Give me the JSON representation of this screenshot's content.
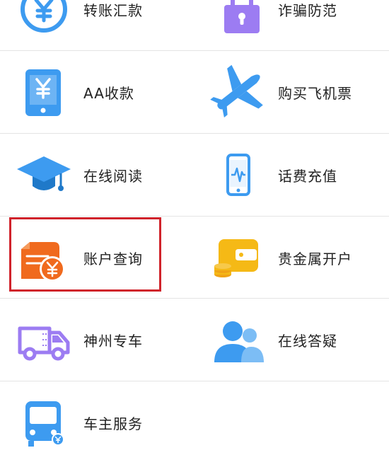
{
  "services": [
    {
      "label": "转账汇款",
      "icon": "yuan-circle-icon"
    },
    {
      "label": "诈骗防范",
      "icon": "padlock-icon"
    },
    {
      "label": "AA收款",
      "icon": "phone-yuan-icon"
    },
    {
      "label": "购买飞机票",
      "icon": "airplane-icon"
    },
    {
      "label": "在线阅读",
      "icon": "graduation-cap-icon"
    },
    {
      "label": "话费充值",
      "icon": "phone-signal-icon"
    },
    {
      "label": "账户查询",
      "icon": "account-query-icon"
    },
    {
      "label": "贵金属开户",
      "icon": "wallet-coins-icon"
    },
    {
      "label": "神州专车",
      "icon": "truck-icon"
    },
    {
      "label": "在线答疑",
      "icon": "users-icon"
    },
    {
      "label": "车主服务",
      "icon": "bus-icon"
    }
  ],
  "highlighted_item": "账户查询",
  "colors": {
    "blue": "#3d9bf0",
    "purple": "#9c7cf2",
    "orange": "#f06a1e",
    "yellow": "#f5b916",
    "highlight_border": "#d0232b"
  }
}
